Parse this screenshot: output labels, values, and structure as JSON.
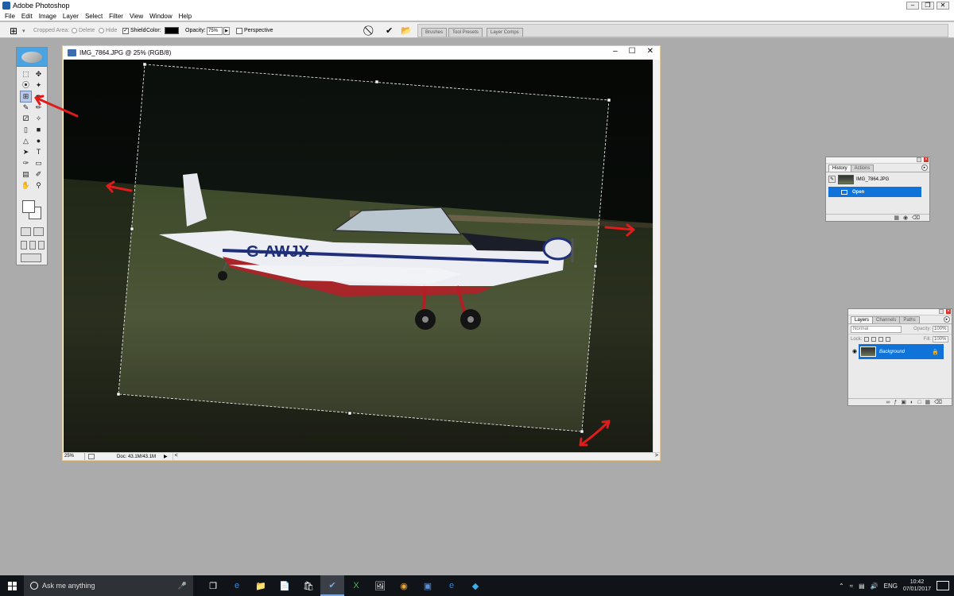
{
  "app": {
    "title": "Adobe Photoshop"
  },
  "menu": [
    "File",
    "Edit",
    "Image",
    "Layer",
    "Select",
    "Filter",
    "View",
    "Window",
    "Help"
  ],
  "options": {
    "cropped_area_label": "Cropped Area:",
    "delete_label": "Delete",
    "hide_label": "Hide",
    "shield_label": "Shield",
    "color_label": "Color:",
    "shield_color": "#000000",
    "opacity_label": "Opacity:",
    "opacity_value": "75%",
    "perspective_label": "Perspective",
    "cancel_symbol": "⃠",
    "commit_symbol": "✔",
    "well_tabs": [
      "Brushes",
      "Tool Presets",
      "Layer Comps"
    ]
  },
  "document": {
    "title": "IMG_7864.JPG @ 25% (RGB/8)",
    "zoom": "25%",
    "doc_info": "Doc: 43.1M/43.1M",
    "aircraft_reg": "G-AWJX"
  },
  "history": {
    "tabs": [
      "History",
      "Actions"
    ],
    "source": "IMG_7864.JPG",
    "states": [
      "Open"
    ]
  },
  "layers": {
    "tabs": [
      "Layers",
      "Channels",
      "Paths"
    ],
    "blend_mode": "Normal",
    "opacity_label": "Opacity:",
    "opacity_value": "100%",
    "lock_label": "Lock:",
    "fill_label": "Fill:",
    "fill_value": "100%",
    "items": [
      {
        "name": "Background",
        "locked": true,
        "visible": true
      }
    ]
  },
  "taskbar": {
    "search_placeholder": "Ask me anything",
    "language": "ENG",
    "time": "10:42",
    "date": "07/01/2017"
  },
  "colors": {
    "accent_selection": "#0f73d9",
    "annotation_arrow": "#e01b1b",
    "taskbar": "#101318"
  }
}
